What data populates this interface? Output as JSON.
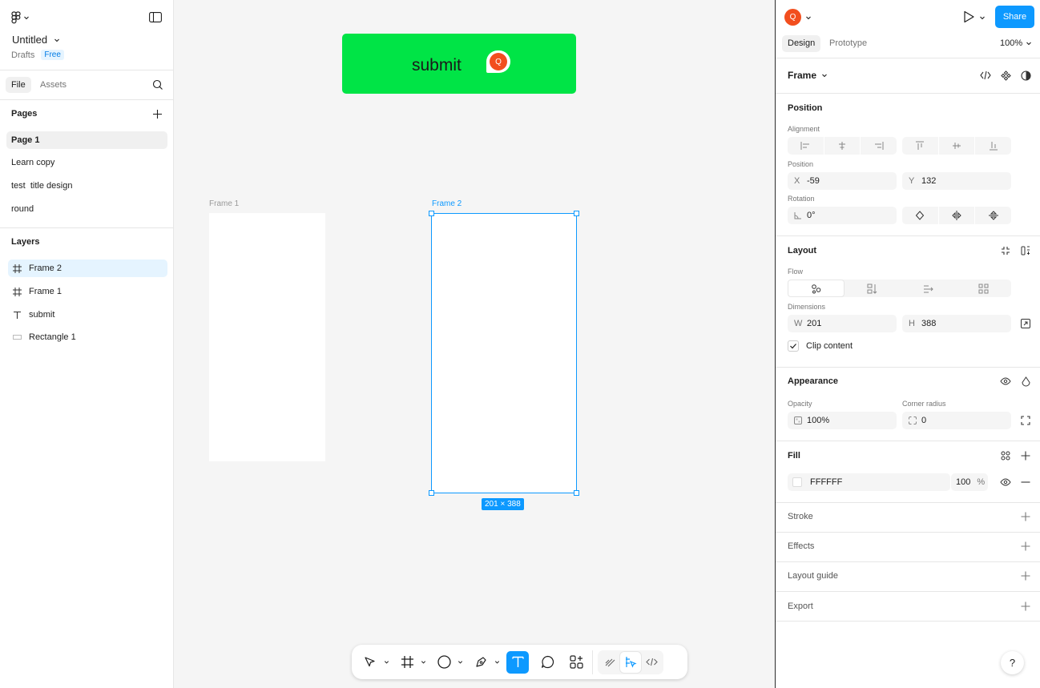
{
  "left_panel": {
    "file_title": "Untitled",
    "location": "Drafts",
    "plan_badge": "Free",
    "tabs": [
      {
        "label": "File"
      },
      {
        "label": "Assets"
      }
    ],
    "pages_header": "Pages",
    "pages": [
      {
        "label": "Page 1",
        "selected": true
      },
      {
        "label": "Learn copy"
      },
      {
        "label": "test  title design"
      },
      {
        "label": "round"
      }
    ],
    "layers_header": "Layers",
    "layers": [
      {
        "label": "Frame 2",
        "icon": "frame-icon",
        "selected": true
      },
      {
        "label": "Frame 1",
        "icon": "frame-icon"
      },
      {
        "label": "submit",
        "icon": "text-icon"
      },
      {
        "label": "Rectangle 1",
        "icon": "rectangle-icon"
      }
    ]
  },
  "canvas": {
    "button_text": "submit",
    "comment_avatar_initial": "Q",
    "frame1_label": "Frame 1",
    "frame2_label": "Frame 2",
    "selection_dimensions": "201 × 388"
  },
  "right_panel": {
    "avatar_initial": "Q",
    "share_label": "Share",
    "tabs": [
      {
        "label": "Design"
      },
      {
        "label": "Prototype"
      }
    ],
    "zoom": "100%",
    "selection_type": "Frame",
    "position": {
      "title": "Position",
      "alignment_label": "Alignment",
      "position_label": "Position",
      "x_prefix": "X",
      "x": "-59",
      "y_prefix": "Y",
      "y": "132",
      "rotation_label": "Rotation",
      "rotation": "0°"
    },
    "layout": {
      "title": "Layout",
      "flow_label": "Flow",
      "dimensions_label": "Dimensions",
      "w_prefix": "W",
      "w": "201",
      "h_prefix": "H",
      "h": "388",
      "clip_content": "Clip content"
    },
    "appearance": {
      "title": "Appearance",
      "opacity_label": "Opacity",
      "opacity": "100%",
      "radius_label": "Corner radius",
      "radius": "0"
    },
    "fill": {
      "title": "Fill",
      "hex": "FFFFFF",
      "opacity": "100",
      "percent": "%"
    },
    "sections": [
      {
        "label": "Stroke"
      },
      {
        "label": "Effects"
      },
      {
        "label": "Layout guide"
      },
      {
        "label": "Export"
      }
    ],
    "help": "?"
  },
  "colors": {
    "accent": "#0d99ff",
    "button_green": "#00e446",
    "avatar": "#f24e1e"
  }
}
